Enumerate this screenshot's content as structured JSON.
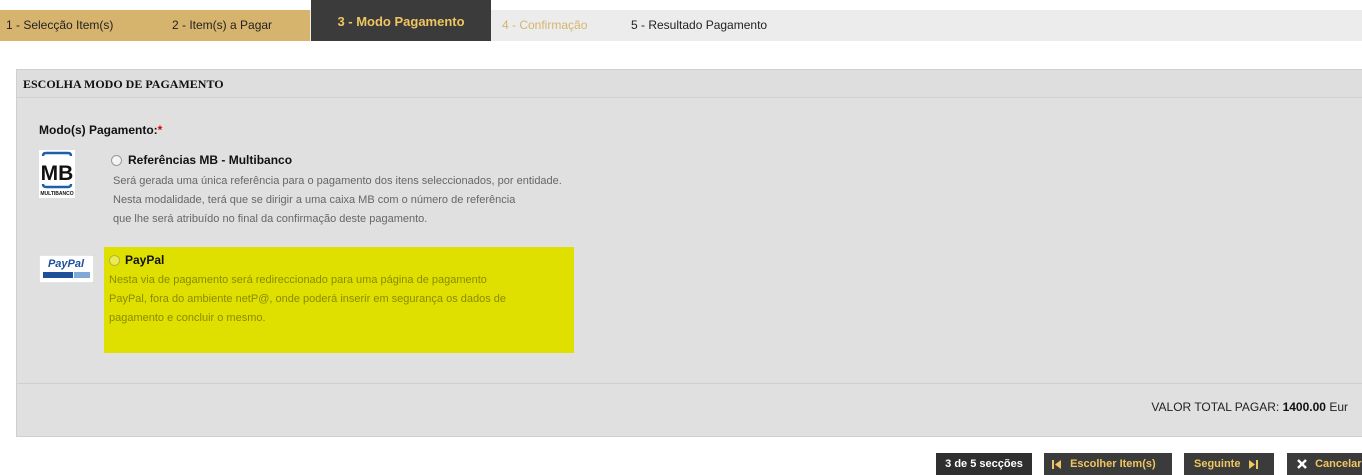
{
  "steps": [
    {
      "label": "1 - Selecção Item(s)"
    },
    {
      "label": "2 - Item(s) a Pagar"
    },
    {
      "label": "3 - Modo Pagamento"
    },
    {
      "label": "4 - Confirmação"
    },
    {
      "label": "5 - Resultado Pagamento"
    }
  ],
  "panel": {
    "title": "ESCOLHA MODO DE PAGAMENTO",
    "field_label": "Modo(s) Pagamento:",
    "required_mark": "*"
  },
  "options": {
    "mb": {
      "logo_text": "MB",
      "logo_subtext": "MULTIBANCO",
      "title": "Referências MB - Multibanco",
      "desc": [
        "Será gerada uma única referência para o pagamento dos itens seleccionados, por entidade.",
        "Nesta modalidade, terá que se dirigir a uma caixa MB com o número de referência",
        "que lhe será atribuído no final da confirmação deste pagamento."
      ]
    },
    "paypal": {
      "logo_text": "PayPal",
      "title": "PayPal",
      "desc": [
        "Nesta via de pagamento será redireccionado para uma página de pagamento",
        "PayPal, fora do ambiente netP@, onde poderá inserir em segurança os dados de",
        "pagamento e concluir o mesmo."
      ]
    }
  },
  "total": {
    "label": "VALOR TOTAL PAGAR:",
    "value": "1400.00",
    "currency": "Eur"
  },
  "buttons": {
    "count": "3 de 5 secções",
    "prev": "Escolher Item(s)",
    "next": "Seguinte",
    "cancel": "Cancelar"
  },
  "colors": {
    "step_done": "#d7b46e",
    "step_active": "#3b3b3b",
    "accent_text": "#f0c660",
    "highlight": "#e0e000"
  }
}
